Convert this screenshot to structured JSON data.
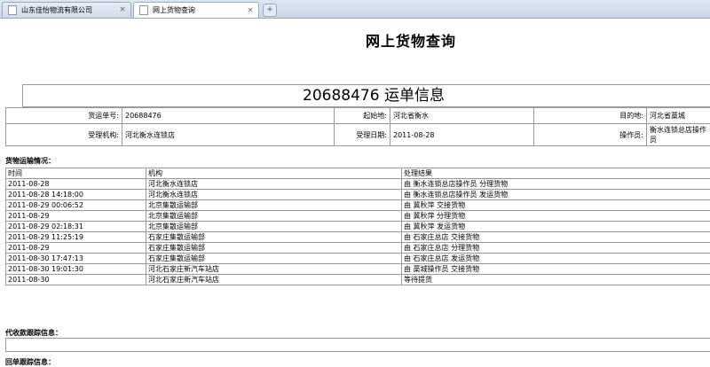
{
  "tabs": [
    {
      "label": "山东佳怡物流有限公司",
      "close": "×"
    },
    {
      "label": "网上货物查询",
      "close": "×"
    }
  ],
  "new_tab": "+",
  "page": {
    "title": "网上货物查询",
    "waybill_header": "20688476 运单信息"
  },
  "info": {
    "row1": [
      {
        "key": "货运单号:",
        "value": "20688476"
      },
      {
        "key": "起始地:",
        "value": "河北省衡水"
      },
      {
        "key": "目的地:",
        "value": "河北省藁城"
      }
    ],
    "row2": [
      {
        "key": "受理机构:",
        "value": "河北衡水连锁店"
      },
      {
        "key": "受理日期:",
        "value": "2011-08-28"
      },
      {
        "key": "操作员:",
        "value": "衡水连锁总店操作员"
      }
    ]
  },
  "tracking": {
    "section_label": "货物运输情况：",
    "headers": [
      "时间",
      "机构",
      "处理结果"
    ],
    "rows": [
      [
        "2011-08-28",
        "河北衡水连锁店",
        "由 衡水连锁总店操作员 分理货物"
      ],
      [
        "2011-08-28 14:18:00",
        "河北衡水连锁店",
        "由 衡水连锁总店操作员 发运货物"
      ],
      [
        "2011-08-29 00:06:52",
        "北京集散运输部",
        "由 冀秋萍 交接货物"
      ],
      [
        "2011-08-29",
        "北京集散运输部",
        "由 冀秋萍 分理货物"
      ],
      [
        "2011-08-29 02:18:31",
        "北京集散运输部",
        "由 冀秋萍 发运货物"
      ],
      [
        "2011-08-29 11:25:19",
        "石家庄集散运输部",
        "由 石家庄总店 交接货物"
      ],
      [
        "2011-08-29",
        "石家庄集散运输部",
        "由 石家庄总店 分理货物"
      ],
      [
        "2011-08-30 17:47:13",
        "石家庄集散运输部",
        "由 石家庄总店 发运货物"
      ],
      [
        "2011-08-30 19:01:30",
        "河北石家庄新汽车站店",
        "由 藁城操作员 交接货物"
      ],
      [
        "2011-08-30",
        "河北石家庄新汽车站店",
        "等待提货"
      ]
    ]
  },
  "cod_section_label": "代收款跟踪信息：",
  "return_section_label": "回单跟踪信息："
}
